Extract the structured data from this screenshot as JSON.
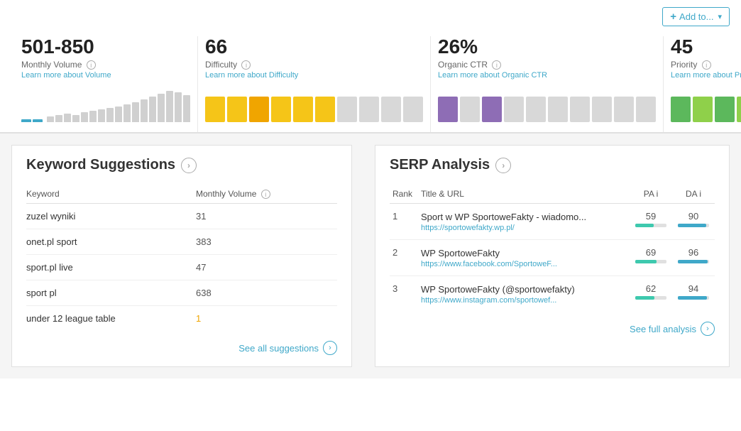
{
  "topbar": {
    "add_to_label": "Add to...",
    "add_to_plus": "+"
  },
  "metrics": {
    "volume": {
      "value": "501-850",
      "label": "Monthly Volume",
      "link": "Learn more about Volume",
      "bars": [
        3,
        5,
        4,
        6,
        8,
        10,
        12,
        14,
        16,
        18,
        20,
        22,
        25,
        28,
        32,
        36,
        40,
        44,
        48
      ]
    },
    "difficulty": {
      "value": "66",
      "label": "Difficulty",
      "link": "Learn more about Difficulty"
    },
    "ctr": {
      "value": "26%",
      "label": "Organic CTR",
      "link": "Learn more about Organic CTR"
    },
    "priority": {
      "value": "45",
      "label": "Priority",
      "link": "Learn more about Priority"
    }
  },
  "keyword_suggestions": {
    "title": "Keyword Suggestions",
    "col_keyword": "Keyword",
    "col_volume": "Monthly Volume",
    "see_all": "See all suggestions",
    "rows": [
      {
        "keyword": "zuzel wyniki",
        "volume": "31",
        "low": false
      },
      {
        "keyword": "onet.pl sport",
        "volume": "383",
        "low": false
      },
      {
        "keyword": "sport.pl live",
        "volume": "47",
        "low": false
      },
      {
        "keyword": "sport pl",
        "volume": "638",
        "low": false
      },
      {
        "keyword": "under 12 league table",
        "volume": "1",
        "low": true
      }
    ]
  },
  "serp_analysis": {
    "title": "SERP Analysis",
    "col_rank": "Rank",
    "col_title_url": "Title & URL",
    "col_pa": "PA",
    "col_da": "DA",
    "see_full": "See full analysis",
    "rows": [
      {
        "rank": "1",
        "title": "Sport w WP SportoweFakty - wiadomo...",
        "url": "https://sportowefakty.wp.pl/",
        "pa": 59,
        "da": 90
      },
      {
        "rank": "2",
        "title": "WP SportoweFakty",
        "url": "https://www.facebook.com/SportoweF...",
        "pa": 69,
        "da": 96
      },
      {
        "rank": "3",
        "title": "WP SportoweFakty (@sportowefakty)",
        "url": "https://www.instagram.com/sportowef...",
        "pa": 62,
        "da": 94
      }
    ]
  }
}
